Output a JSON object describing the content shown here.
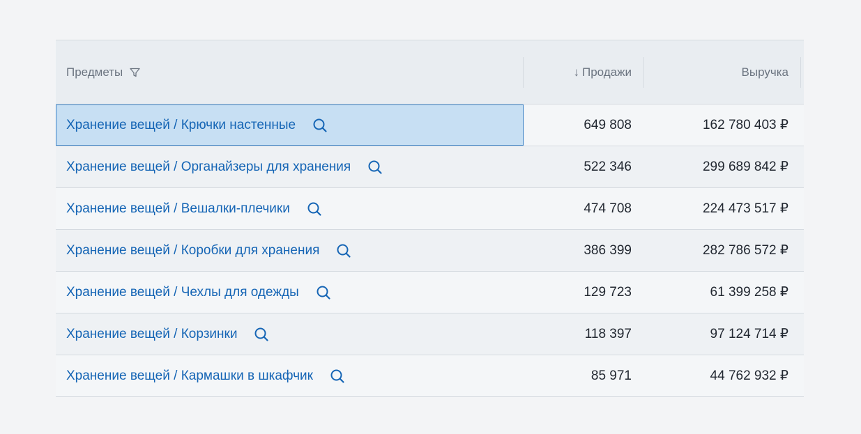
{
  "table": {
    "columns": {
      "items": "Предметы",
      "sales_arrow": "↓",
      "sales": "Продажи",
      "revenue": "Выручка"
    },
    "rows": [
      {
        "name": "Хранение вещей / Крючки настенные",
        "sales": "649 808",
        "revenue": "162 780 403 ₽"
      },
      {
        "name": "Хранение вещей / Органайзеры для хранения",
        "sales": "522 346",
        "revenue": "299 689 842 ₽"
      },
      {
        "name": "Хранение вещей / Вешалки-плечики",
        "sales": "474 708",
        "revenue": "224 473 517 ₽"
      },
      {
        "name": "Хранение вещей / Коробки для хранения",
        "sales": "386 399",
        "revenue": "282 786 572 ₽"
      },
      {
        "name": "Хранение вещей / Чехлы для одежды",
        "sales": "129 723",
        "revenue": "61 399 258 ₽"
      },
      {
        "name": "Хранение вещей / Корзинки",
        "sales": "118 397",
        "revenue": "97 124 714 ₽"
      },
      {
        "name": "Хранение вещей / Кармашки в шкафчик",
        "sales": "85 971",
        "revenue": "44 762 932 ₽"
      }
    ],
    "selected_row": 0
  },
  "icons": {
    "filter": "filter-icon",
    "search": "search-icon"
  },
  "colors": {
    "link": "#1565b5",
    "selected_bg": "#c7dff3",
    "selected_border": "#3d83c7"
  }
}
